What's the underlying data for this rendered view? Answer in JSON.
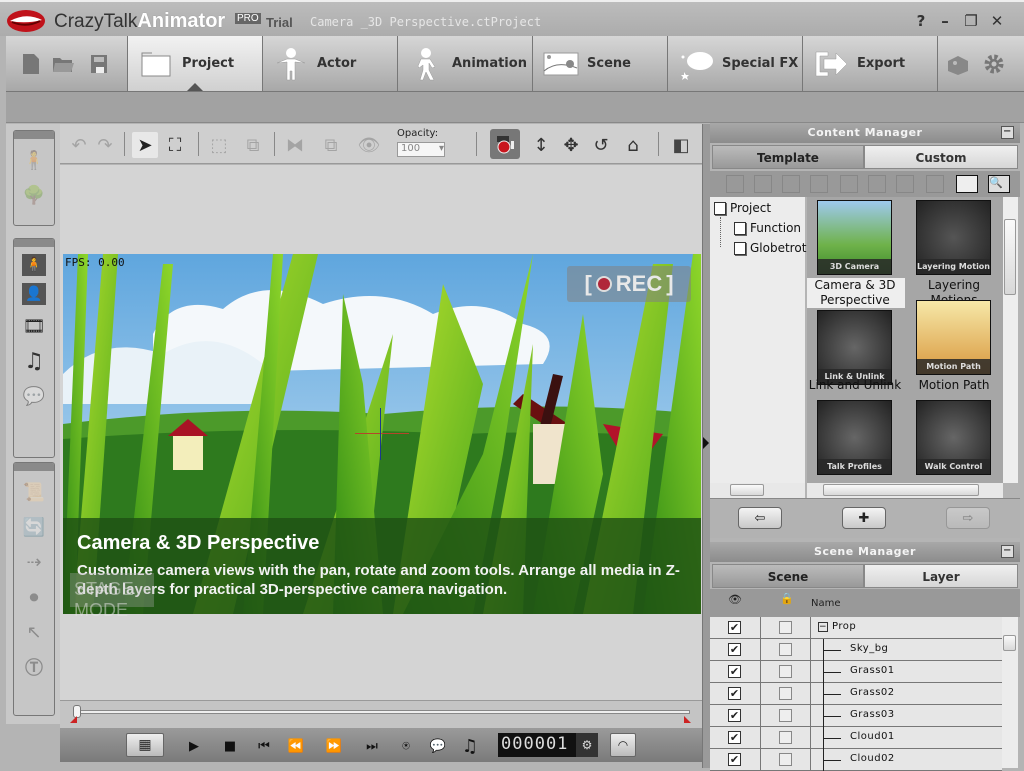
{
  "titlebar": {
    "brand_prefix": "CrazyTalk",
    "brand_name": "Animator",
    "edition": "PRO",
    "trial": "Trial",
    "project_file": "Camera _3D Perspective.ctProject",
    "help": "?",
    "minimize": "–",
    "restore": "❐",
    "close": "✕"
  },
  "main_tabs": [
    {
      "label": "Project",
      "icon": "folder-icon",
      "active": true
    },
    {
      "label": "Actor",
      "icon": "actor-icon",
      "active": false
    },
    {
      "label": "Animation",
      "icon": "running-figure-icon",
      "active": false
    },
    {
      "label": "Scene",
      "icon": "landscape-icon",
      "active": false
    },
    {
      "label": "Special FX",
      "icon": "speech-bubble-stars-icon",
      "active": false
    },
    {
      "label": "Export",
      "icon": "export-arrow-icon",
      "active": false
    }
  ],
  "stage_toolbar": {
    "opacity_label": "Opacity:",
    "opacity_value": "100"
  },
  "stage": {
    "fps": "FPS: 0.00",
    "rec_label": "REC",
    "caption_title": "Camera & 3D Perspective",
    "caption_body": "Customize camera views with the pan, rotate and zoom tools. Arrange all media in Z-depth layers for practical 3D-perspective camera navigation.",
    "stage_mode_watermark": "STAGE MODE"
  },
  "playback": {
    "frame_counter": "000001",
    "timeline_progress": 0
  },
  "content_manager": {
    "title": "Content Manager",
    "tabs": [
      {
        "label": "Template",
        "active": true
      },
      {
        "label": "Custom",
        "active": false
      }
    ],
    "tree": [
      {
        "label": "Project",
        "level": 0
      },
      {
        "label": "Function",
        "level": 1
      },
      {
        "label": "Globetrot",
        "level": 1
      }
    ],
    "items": [
      {
        "thumb_label": "3D Camera",
        "caption": "Camera & 3D Perspective",
        "selected": true
      },
      {
        "thumb_label": "Layering Motion",
        "caption": "Layering Motions",
        "selected": false
      },
      {
        "thumb_label": "Link & Unlink",
        "caption": "Link and Unlink",
        "selected": false
      },
      {
        "thumb_label": "Motion Path",
        "caption": "Motion Path",
        "selected": false
      },
      {
        "thumb_label": "Talk Profiles",
        "caption": "",
        "selected": false
      },
      {
        "thumb_label": "Walk Control",
        "caption": "",
        "selected": false
      }
    ]
  },
  "scene_manager": {
    "title": "Scene Manager",
    "tabs": [
      {
        "label": "Scene",
        "active": true
      },
      {
        "label": "Layer",
        "active": false
      }
    ],
    "columns": {
      "visible": "eye-icon",
      "lock": "lock-icon",
      "name": "Name"
    },
    "rows": [
      {
        "name": "Prop",
        "group": true,
        "visible": true,
        "locked": false
      },
      {
        "name": "Sky_bg",
        "group": false,
        "visible": true,
        "locked": false
      },
      {
        "name": "Grass01",
        "group": false,
        "visible": true,
        "locked": false
      },
      {
        "name": "Grass02",
        "group": false,
        "visible": true,
        "locked": false
      },
      {
        "name": "Grass03",
        "group": false,
        "visible": true,
        "locked": false
      },
      {
        "name": "Cloud01",
        "group": false,
        "visible": true,
        "locked": false
      },
      {
        "name": "Cloud02",
        "group": false,
        "visible": true,
        "locked": false
      }
    ]
  }
}
